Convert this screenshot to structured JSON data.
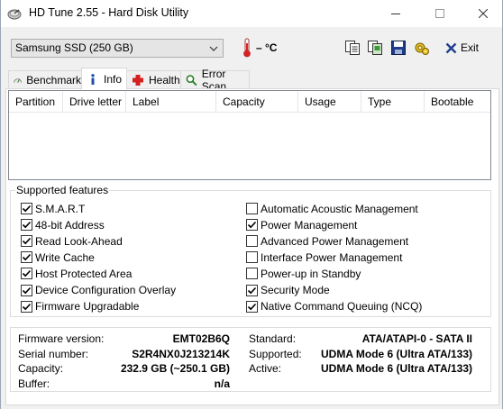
{
  "window": {
    "title": "HD Tune 2.55 - Hard Disk Utility",
    "minimize_glyph": "—",
    "maximize_glyph": "☐",
    "close_glyph": "✕"
  },
  "toolbar": {
    "drive": "Samsung SSD (250 GB)",
    "temperature": "– °C",
    "exit_label": "Exit",
    "icons": [
      "copy-info-icon",
      "copy-screenshot-icon",
      "save-icon",
      "options-icon"
    ]
  },
  "tabs": [
    {
      "label": "Benchmark",
      "icon": "benchmark-icon",
      "active": false
    },
    {
      "label": "Info",
      "icon": "info-icon",
      "active": true
    },
    {
      "label": "Health",
      "icon": "health-icon",
      "active": false
    },
    {
      "label": "Error Scan",
      "icon": "error-scan-icon",
      "active": false
    }
  ],
  "partitions": {
    "columns": [
      "Partition",
      "Drive letter",
      "Label",
      "Capacity",
      "Usage",
      "Type",
      "Bootable"
    ],
    "rows": []
  },
  "features": {
    "title": "Supported features",
    "left": [
      {
        "label": "S.M.A.R.T",
        "checked": true
      },
      {
        "label": "48-bit Address",
        "checked": true
      },
      {
        "label": "Read Look-Ahead",
        "checked": true
      },
      {
        "label": "Write Cache",
        "checked": true
      },
      {
        "label": "Host Protected Area",
        "checked": true
      },
      {
        "label": "Device Configuration Overlay",
        "checked": true
      },
      {
        "label": "Firmware Upgradable",
        "checked": true
      }
    ],
    "right": [
      {
        "label": "Automatic Acoustic Management",
        "checked": false
      },
      {
        "label": "Power Management",
        "checked": true
      },
      {
        "label": "Advanced Power Management",
        "checked": false
      },
      {
        "label": "Interface Power Management",
        "checked": false
      },
      {
        "label": "Power-up in Standby",
        "checked": false
      },
      {
        "label": "Security Mode",
        "checked": true
      },
      {
        "label": "Native Command Queuing (NCQ)",
        "checked": true
      }
    ]
  },
  "info": {
    "firmware_label": "Firmware version:",
    "firmware": "EMT02B6Q",
    "serial_label": "Serial number:",
    "serial": "S2R4NX0J213214K",
    "capacity_label": "Capacity:",
    "capacity": "232.9 GB (~250.1 GB)",
    "buffer_label": "Buffer:",
    "buffer": "n/a",
    "standard_label": "Standard:",
    "standard": "ATA/ATAPI-0 - SATA II",
    "supported_label": "Supported:",
    "supported": "UDMA Mode 6 (Ultra ATA/133)",
    "active_label": "Active:",
    "active": "UDMA Mode 6 (Ultra ATA/133)"
  },
  "colors": {
    "accent_blue": "#1f5fbf",
    "health_red": "#d42020",
    "check_black": "#000000"
  }
}
